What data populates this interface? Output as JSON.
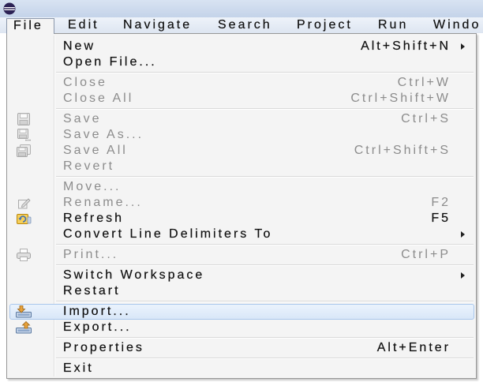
{
  "title_bar": {
    "app_icon": "eclipse-logo-icon"
  },
  "menubar": {
    "items": [
      {
        "label": "File",
        "active": true
      },
      {
        "label": "Edit"
      },
      {
        "label": "Navigate"
      },
      {
        "label": "Search"
      },
      {
        "label": "Project"
      },
      {
        "label": "Run"
      },
      {
        "label": "Windo"
      }
    ]
  },
  "file_menu": {
    "groups": [
      [
        {
          "label": "New",
          "shortcut": "Alt+Shift+N",
          "submenu": true,
          "enabled": true
        },
        {
          "label": "Open File...",
          "enabled": true
        }
      ],
      [
        {
          "label": "Close",
          "shortcut": "Ctrl+W",
          "enabled": false
        },
        {
          "label": "Close All",
          "shortcut": "Ctrl+Shift+W",
          "enabled": false
        }
      ],
      [
        {
          "label": "Save",
          "shortcut": "Ctrl+S",
          "enabled": false,
          "icon": "save-icon"
        },
        {
          "label": "Save As...",
          "enabled": false,
          "icon": "save-as-icon"
        },
        {
          "label": "Save All",
          "shortcut": "Ctrl+Shift+S",
          "enabled": false,
          "icon": "save-all-icon"
        },
        {
          "label": "Revert",
          "enabled": false
        }
      ],
      [
        {
          "label": "Move...",
          "enabled": false
        },
        {
          "label": "Rename...",
          "shortcut": "F2",
          "enabled": false,
          "icon": "rename-icon"
        },
        {
          "label": "Refresh",
          "shortcut": "F5",
          "enabled": true,
          "icon": "refresh-icon"
        },
        {
          "label": "Convert Line Delimiters To",
          "submenu": true,
          "enabled": true
        }
      ],
      [
        {
          "label": "Print...",
          "shortcut": "Ctrl+P",
          "enabled": false,
          "icon": "print-icon"
        }
      ],
      [
        {
          "label": "Switch Workspace",
          "submenu": true,
          "enabled": true
        },
        {
          "label": "Restart",
          "enabled": true
        }
      ],
      [
        {
          "label": "Import...",
          "enabled": true,
          "highlighted": true,
          "icon": "import-icon"
        },
        {
          "label": "Export...",
          "enabled": true,
          "icon": "export-icon"
        }
      ],
      [
        {
          "label": "Properties",
          "shortcut": "Alt+Enter",
          "enabled": true
        }
      ],
      [
        {
          "label": "Exit",
          "enabled": true
        }
      ]
    ]
  },
  "colors": {
    "highlight_background": "#dce8f8",
    "highlight_border": "#a9c7ec",
    "disabled_text": "#8c8c8c",
    "app_logo": "#2c2255"
  }
}
